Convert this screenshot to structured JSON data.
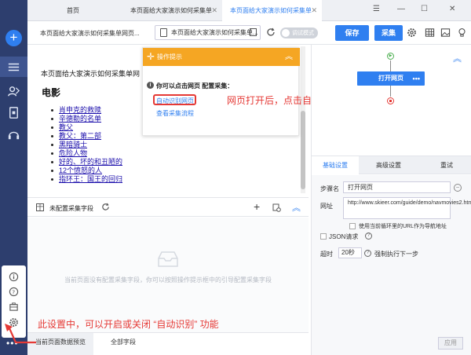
{
  "tabs": [
    {
      "label": "首页"
    },
    {
      "label": "本页面给大家演示如何采集单"
    },
    {
      "label": "本页面给大家演示如何采集单"
    }
  ],
  "toolbar": {
    "url_title": "本页面给大家演示如何采集单网页...",
    "url_box": "本页面给大家演示如何采集单...",
    "debug_label": "调试模式",
    "save_label": "保存",
    "collect_label": "采集"
  },
  "page": {
    "head": "本页面给大家演示如何采集单网",
    "subtitle": "电影",
    "movies": [
      "肖申克的救赎",
      "辛德勒的名单",
      "教父",
      "教父：第二部",
      "黑暗骑士",
      "危险人物",
      "好的、坏的和丑陋的",
      "12个愤怒的人",
      "指环王：国王的回归"
    ]
  },
  "tip": {
    "header": "操作提示",
    "line1": "你可以点击网页    配置采集：",
    "link1": "自动识别网页",
    "link2": "查看采集流程"
  },
  "annotations": {
    "a1": "网页打开后，点击自动识别网页",
    "a2": "此设置中，可以开启或关闭 “自动识别” 功能"
  },
  "fields": {
    "title": "未配置采集字段",
    "empty": "当前页面没有配置采集字段，你可以按照操作提示框中的引导配置采集字段"
  },
  "bottom_tabs": [
    "当前页面数据预览",
    "全部字段"
  ],
  "flow": {
    "node_label": "打开网页"
  },
  "right_tabs": [
    "基础设置",
    "高级设置",
    "重试"
  ],
  "settings": {
    "step_name_label": "步骤名",
    "step_name_value": "打开网页",
    "url_label": "网址",
    "url_value": "http://www.skieer.com/guide/demo/navmovies2.html",
    "loop_label": "使用当前循环里的URL作为导航地址",
    "json_label": "JSON请求",
    "timeout_label": "超时",
    "timeout_value": "20秒",
    "timeout_suffix": "强制执行下一步",
    "apply_label": "应用"
  },
  "colors": {
    "accent": "#2f7ff0",
    "sidebar": "#2d3e6e",
    "tip_header": "#f5a623",
    "annotation": "#e53935"
  }
}
